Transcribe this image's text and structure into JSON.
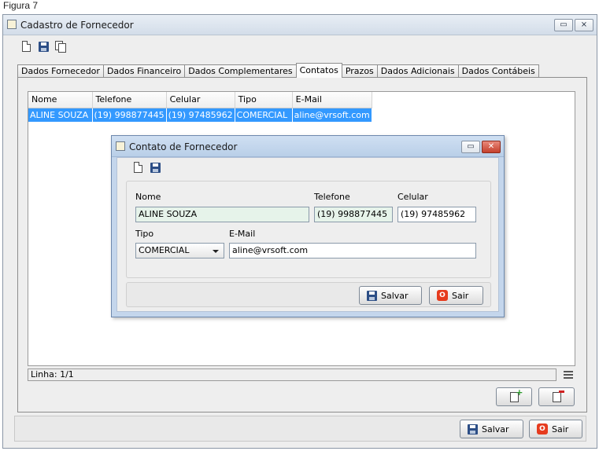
{
  "caption": "Figura 7",
  "main_window": {
    "title": "Cadastro de Fornecedor",
    "controls": {
      "restore": "▭",
      "close": "⨯"
    },
    "tabs": [
      {
        "label": "Dados Fornecedor"
      },
      {
        "label": "Dados Financeiro"
      },
      {
        "label": "Dados Complementares"
      },
      {
        "label": "Contatos",
        "active": true
      },
      {
        "label": "Prazos"
      },
      {
        "label": "Dados Adicionais"
      },
      {
        "label": "Dados Contábeis"
      }
    ],
    "table": {
      "headers": [
        "Nome",
        "Telefone",
        "Celular",
        "Tipo",
        "E-Mail"
      ],
      "rows": [
        [
          "ALINE SOUZA",
          "(19) 998877445",
          "(19) 97485962",
          "COMERCIAL",
          "aline@vrsoft.com"
        ]
      ]
    },
    "status": "Linha: 1/1",
    "buttons": {
      "save": "Salvar",
      "exit": "Sair"
    }
  },
  "dialog": {
    "title": "Contato de Fornecedor",
    "controls": {
      "restore": "▭",
      "close": "✕"
    },
    "labels": {
      "nome": "Nome",
      "telefone": "Telefone",
      "celular": "Celular",
      "tipo": "Tipo",
      "email": "E-Mail"
    },
    "values": {
      "nome": "ALINE SOUZA",
      "telefone": "(19) 998877445",
      "celular": "(19) 97485962",
      "tipo": "COMERCIAL",
      "email": "aline@vrsoft.com"
    },
    "buttons": {
      "save": "Salvar",
      "exit": "Sair"
    }
  },
  "icons": {
    "new": "new-document-icon",
    "save": "floppy-disk-icon",
    "copy": "copy-document-icon",
    "add_row": "add-document-icon",
    "remove_row": "remove-document-icon",
    "exit": "stop-icon",
    "stop_glyph": "O"
  },
  "colors": {
    "selection": "#3399ff",
    "dialog_frame": "#c4d6ec",
    "close_red": "#c4402c"
  }
}
